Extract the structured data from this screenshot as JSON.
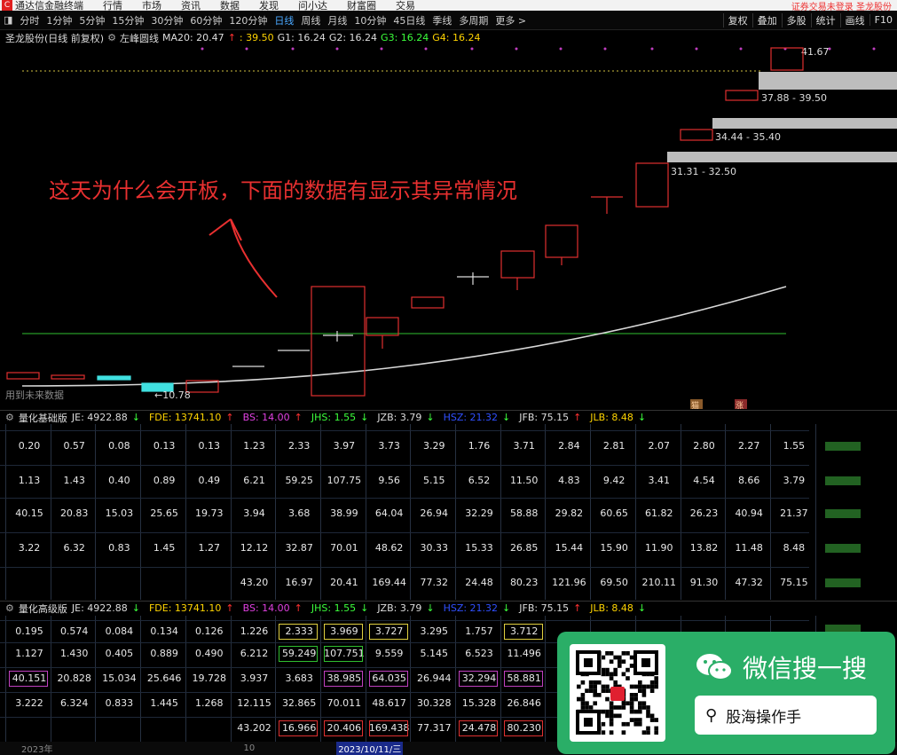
{
  "menu": {
    "logo": "C",
    "items": [
      "通达信金融终端",
      "行情",
      "市场",
      "资讯",
      "数据",
      "发现",
      "问小达",
      "财富圈",
      "交易"
    ],
    "right": "证券交易未登录  圣龙股份"
  },
  "toolbar": {
    "items": [
      "分时",
      "1分钟",
      "5分钟",
      "15分钟",
      "30分钟",
      "60分钟",
      "120分钟",
      "日线",
      "周线",
      "月线",
      "10分钟",
      "45日线",
      "季线",
      "多周期",
      "更多 >"
    ],
    "active_index": 7,
    "right": [
      "复权",
      "叠加",
      "多股",
      "统计",
      "画线",
      "F10"
    ]
  },
  "info": {
    "title": "圣龙股份(日线 前复权)",
    "indicator": "左峰圆线",
    "ma20": "MA20: 20.47",
    "ma20_arrow": "↑",
    "v1": ": 39.50",
    "g1": "G1: 16.24",
    "g2": "G2: 16.24",
    "g3": "G3: 16.24",
    "g4": "G4: 16.24"
  },
  "chart": {
    "annotation": "这天为什么会开板，下面的数据有显示其异常情况",
    "price_top": "41.67",
    "zones": [
      "37.88 - 39.50",
      "34.44 - 35.40",
      "31.31 - 32.50"
    ],
    "low_label": "←10.78",
    "future_label": "用到未来数据",
    "badge1": "猫",
    "badge2": "涨"
  },
  "basic": {
    "name": "量化基础版",
    "je": "JE: 4922.88",
    "je_a": "↓",
    "fde": "FDE: 13741.10",
    "fde_a": "↑",
    "bs": "BS: 14.00",
    "bs_a": "↑",
    "jhs": "JHS: 1.55",
    "jhs_a": "↓",
    "jzb": "JZB: 3.79",
    "jzb_a": "↓",
    "hsz": "HSZ: 21.32",
    "hsz_a": "↓",
    "jfb": "JFB: 75.15",
    "jfb_a": "↑",
    "jlb": "JLB: 8.48",
    "jlb_a": "↓",
    "rows": [
      [
        "0.20",
        "0.57",
        "0.08",
        "0.13",
        "0.13",
        "1.23",
        "2.33",
        "3.97",
        "3.73",
        "3.29",
        "1.76",
        "3.71",
        "2.84",
        "2.81",
        "2.07",
        "2.80",
        "2.27",
        "1.55"
      ],
      [
        "1.13",
        "1.43",
        "0.40",
        "0.89",
        "0.49",
        "6.21",
        "59.25",
        "107.75",
        "9.56",
        "5.15",
        "6.52",
        "11.50",
        "4.83",
        "9.42",
        "3.41",
        "4.54",
        "8.66",
        "3.79"
      ],
      [
        "40.15",
        "20.83",
        "15.03",
        "25.65",
        "19.73",
        "3.94",
        "3.68",
        "38.99",
        "64.04",
        "26.94",
        "32.29",
        "58.88",
        "29.82",
        "60.65",
        "61.82",
        "26.23",
        "40.94",
        "21.37"
      ],
      [
        "3.22",
        "6.32",
        "0.83",
        "1.45",
        "1.27",
        "12.12",
        "32.87",
        "70.01",
        "48.62",
        "30.33",
        "15.33",
        "26.85",
        "15.44",
        "15.90",
        "11.90",
        "13.82",
        "11.48",
        "8.48"
      ],
      [
        "",
        "",
        "",
        "",
        "",
        "43.20",
        "16.97",
        "20.41",
        "169.44",
        "77.32",
        "24.48",
        "80.23",
        "121.96",
        "69.50",
        "210.11",
        "91.30",
        "47.32",
        "75.15"
      ]
    ]
  },
  "advanced": {
    "name": "量化高级版",
    "je": "JE: 4922.88",
    "je_a": "↓",
    "fde": "FDE: 13741.10",
    "fde_a": "↑",
    "bs": "BS: 14.00",
    "bs_a": "↑",
    "jhs": "JHS: 1.55",
    "jhs_a": "↓",
    "jzb": "JZB: 3.79",
    "jzb_a": "↓",
    "hsz": "HSZ: 21.32",
    "hsz_a": "↓",
    "jfb": "JFB: 75.15",
    "jfb_a": "↑",
    "jlb": "JLB: 8.48",
    "jlb_a": "↓",
    "rows": [
      [
        "0.195",
        "0.574",
        "0.084",
        "0.134",
        "0.126",
        "1.226",
        "2.333",
        "3.969",
        "3.727",
        "3.295",
        "1.757",
        "3.712"
      ],
      [
        "1.127",
        "1.430",
        "0.405",
        "0.889",
        "0.490",
        "6.212",
        "59.249",
        "107.751",
        "9.559",
        "5.145",
        "6.523",
        "11.496"
      ],
      [
        "40.151",
        "20.828",
        "15.034",
        "25.646",
        "19.728",
        "3.937",
        "3.683",
        "38.985",
        "64.035",
        "26.944",
        "32.294",
        "58.881"
      ],
      [
        "3.222",
        "6.324",
        "0.833",
        "1.445",
        "1.268",
        "12.115",
        "32.865",
        "70.011",
        "48.617",
        "30.328",
        "15.328",
        "26.846"
      ],
      [
        "",
        "",
        "",
        "",
        "",
        "43.202",
        "16.966",
        "20.406",
        "169.438",
        "77.317",
        "24.478",
        "80.230"
      ]
    ]
  },
  "status": {
    "year": "2023年",
    "mark": "10",
    "date": "2023/10/11/三"
  },
  "wechat": {
    "title": "微信搜一搜",
    "query": "股海操作手"
  }
}
